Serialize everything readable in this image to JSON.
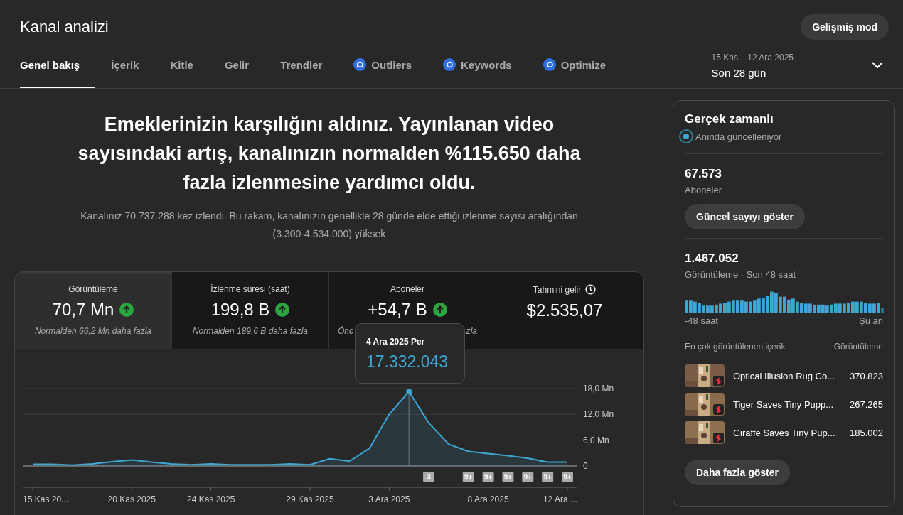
{
  "header": {
    "title": "Kanal analizi",
    "advanced_button": "Gelişmiş mod"
  },
  "tabs": [
    {
      "label": "Genel bakış",
      "selected": true,
      "kind": "plain"
    },
    {
      "label": "İçerik",
      "selected": false,
      "kind": "plain"
    },
    {
      "label": "Kitle",
      "selected": false,
      "kind": "plain"
    },
    {
      "label": "Gelir",
      "selected": false,
      "kind": "plain"
    },
    {
      "label": "Trendler",
      "selected": false,
      "kind": "plain"
    },
    {
      "label": "Outliers",
      "selected": false,
      "kind": "extension"
    },
    {
      "label": "Keywords",
      "selected": false,
      "kind": "extension"
    },
    {
      "label": "Optimize",
      "selected": false,
      "kind": "extension"
    }
  ],
  "date_range": {
    "range": "15 Kas – 12 Ara 2025",
    "label": "Son 28 gün"
  },
  "summary": {
    "headline": "Emeklerinizin karşılığını aldınız. Yayınlanan video sayısındaki artış, kanalınızın normalden %115.650 daha fazla izlenmesine yardımcı oldu.",
    "detail": "Kanalınız 70.737.288 kez izlendi. Bu rakam, kanalınızın genellikle 28 günde elde ettiği izlenme sayısı aralığından (3.300-4.534.000) yüksek"
  },
  "metrics": [
    {
      "label": "Görüntüleme",
      "value": "70,7 Mn",
      "rising": true,
      "note_parts": [
        "Normalden 66,2 Mn daha fazla"
      ],
      "selected": true,
      "info": false
    },
    {
      "label": "İzlenme süresi (saat)",
      "value": "199,8 B",
      "rising": true,
      "note_parts": [
        "Normalden 189,6 B daha fazla"
      ],
      "selected": false,
      "info": false
    },
    {
      "label": "Aboneler",
      "value": "+54,7 B",
      "rising": true,
      "note_parts": [
        "Önc",
        "zla"
      ],
      "selected": false,
      "info": false
    },
    {
      "label": "Tahmini gelir",
      "value": "$2.535,07",
      "rising": false,
      "selected": false,
      "info": true
    }
  ],
  "chart": {
    "tooltip": {
      "date": "4 Ara 2025 Per",
      "value": "17.332.043"
    },
    "chart_data": {
      "type": "area",
      "categories": [
        "15 Kas 20...",
        null,
        null,
        null,
        null,
        "20 Kas 2025",
        null,
        null,
        null,
        "24 Kas 2025",
        null,
        null,
        null,
        null,
        "29 Kas 2025",
        null,
        null,
        null,
        "3 Ara 2025",
        null,
        null,
        null,
        null,
        "8 Ara 2025",
        null,
        null,
        null,
        "12 Ara ..."
      ],
      "series": [
        {
          "color": "#3ea6d2",
          "values": [
            0.4,
            0.4,
            0.2,
            0.5,
            1.0,
            1.4,
            0.9,
            0.5,
            0.3,
            0.5,
            0.3,
            0.3,
            0.3,
            0.5,
            0.3,
            1.7,
            1.1,
            4.1,
            12.0,
            17.3,
            10.0,
            5.1,
            3.4,
            2.9,
            2.4,
            1.8,
            0.9,
            0.9
          ]
        }
      ],
      "ylim": [
        0,
        18
      ],
      "yticks": [
        {
          "value": 0,
          "label": "0"
        },
        {
          "value": 6,
          "label": "6,0 Mn"
        },
        {
          "value": 12,
          "label": "12,0 Mn"
        },
        {
          "value": 18,
          "label": "18,0 Mn"
        }
      ]
    },
    "upload_markers": [
      "3",
      "9+",
      "9+",
      "9+",
      "9+",
      "9+",
      "9+"
    ]
  },
  "realtime": {
    "title": "Gerçek zamanlı",
    "status": "Anında güncelleniyor",
    "subscribers": {
      "value": "67.573",
      "label": "Aboneler",
      "button": "Güncel sayıyı göster"
    },
    "views": {
      "value": "1.467.052",
      "label": "Görüntüleme · Son 48 saat",
      "axis_start": "-48 saat",
      "axis_end": "Şu an"
    },
    "top_header": {
      "left": "En çok görüntülenen içerik",
      "right": "Görüntüleme"
    },
    "top_content": [
      {
        "title": "Optical Illusion Rug Co...",
        "views": "370.823"
      },
      {
        "title": "Tiger Saves Tiny Pupp...",
        "views": "267.265"
      },
      {
        "title": "Giraffe Saves Tiny Pup...",
        "views": "185.002"
      }
    ],
    "more_button": "Daha fazla göster"
  }
}
